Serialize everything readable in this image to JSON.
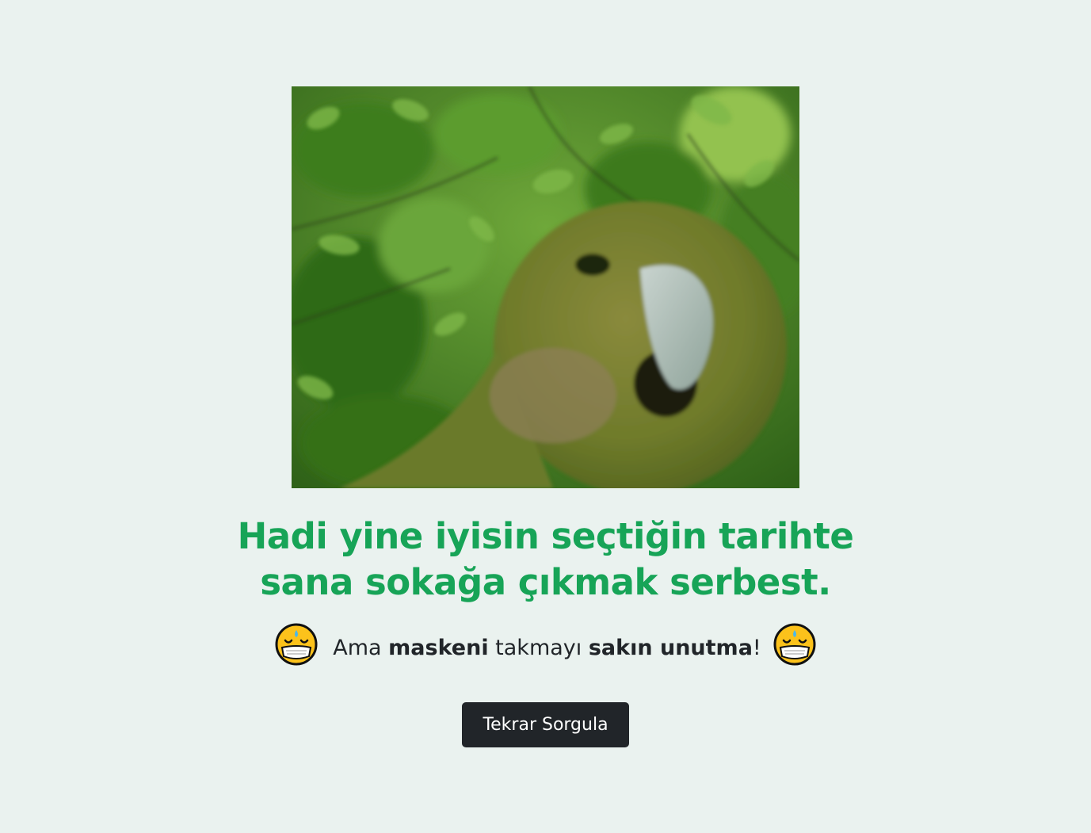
{
  "image": {
    "alt": "kakapo parrot in green foliage",
    "icon": "parrot-photo"
  },
  "headline": {
    "line1": "Hadi yine iyisin seçtiğin tarihte",
    "line2": "sana sokağa çıkmak serbest."
  },
  "reminder": {
    "part1": "Ama ",
    "bold1": "maskeni",
    "part2": " takmayı ",
    "bold2": "sakın unutma",
    "part3": "!",
    "emoji_icon": "face-with-medical-mask-sweat-icon"
  },
  "button": {
    "label": "Tekrar Sorgula"
  },
  "colors": {
    "background": "#eaf2ef",
    "headline": "#17a457",
    "button_bg": "#212529",
    "button_text": "#ffffff"
  }
}
